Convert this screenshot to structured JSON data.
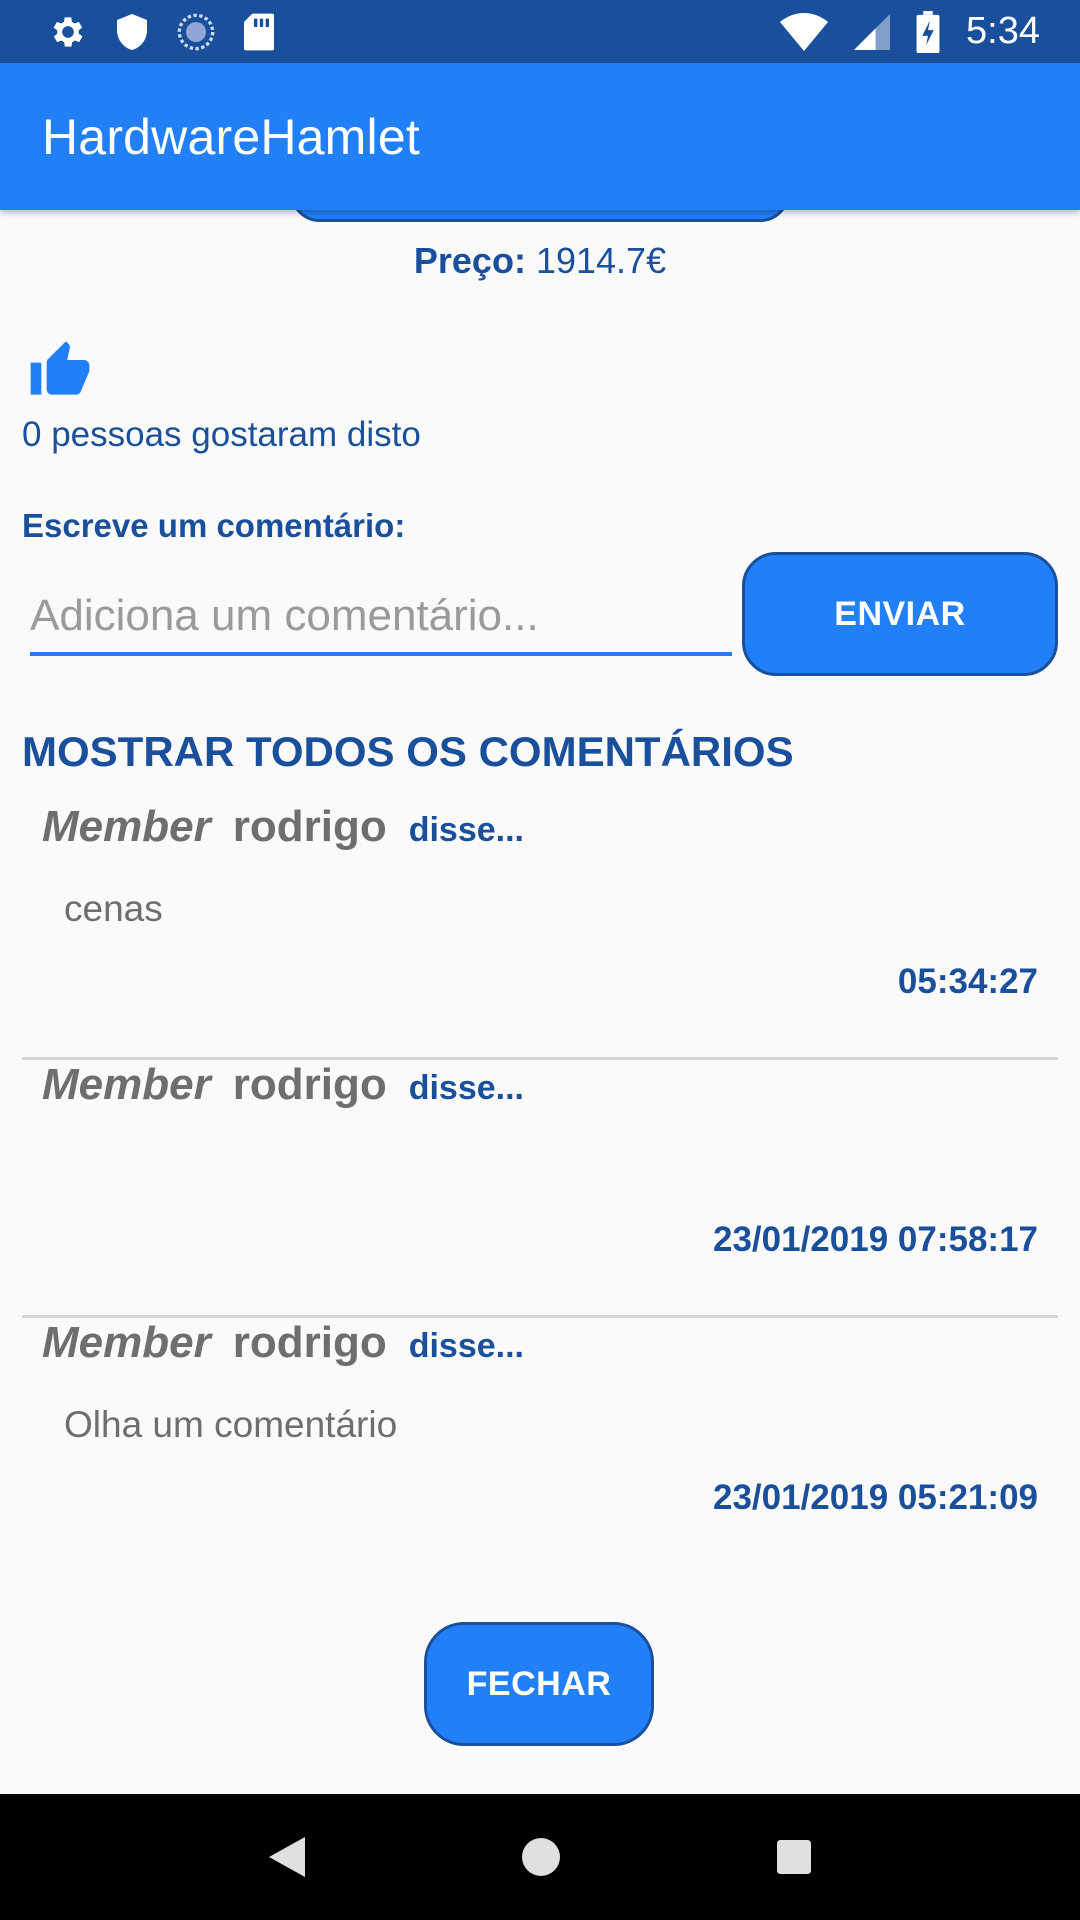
{
  "status_bar": {
    "time": "5:34",
    "icons": [
      "settings-icon",
      "shield-icon",
      "sync-icon",
      "sd-card-icon",
      "wifi-icon",
      "signal-icon",
      "battery-charging-icon"
    ]
  },
  "app_bar": {
    "title": "HardwareHamlet"
  },
  "product": {
    "price_label": "Preço:",
    "price_value": "1914.7€"
  },
  "likes": {
    "icon": "thumbs-up-icon",
    "text": "0 pessoas gostaram disto"
  },
  "comment_form": {
    "label": "Escreve um comentário:",
    "placeholder": "Adiciona um comentário...",
    "value": "",
    "send_label": "ENVIAR"
  },
  "show_all_label": "MOSTRAR TODOS OS COMENTÁRIOS",
  "comments": [
    {
      "role": "Member",
      "user": "rodrigo",
      "said": "disse...",
      "body": "cenas",
      "time": "05:34:27"
    },
    {
      "role": "Member",
      "user": "rodrigo",
      "said": "disse...",
      "body": "",
      "time": "23/01/2019 07:58:17"
    },
    {
      "role": "Member",
      "user": "rodrigo",
      "said": "disse...",
      "body": "Olha um comentário",
      "time": "23/01/2019 05:21:09"
    }
  ],
  "close_label": "FECHAR",
  "nav_bar": {
    "icons": [
      "back-icon",
      "home-icon",
      "recents-icon"
    ]
  },
  "colors": {
    "primary": "#2180f8",
    "primary_dark": "#1a4f9c",
    "text_gray": "#6e6e6e",
    "background": "#fafafa"
  }
}
